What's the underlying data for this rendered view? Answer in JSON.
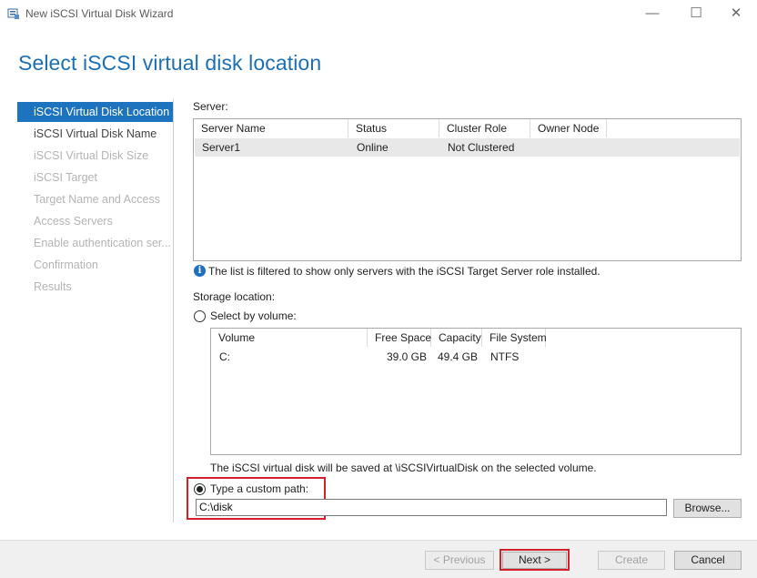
{
  "window": {
    "title": "New iSCSI Virtual Disk Wizard",
    "minimize_glyph": "—",
    "maximize_glyph": "☐",
    "close_glyph": "✕"
  },
  "page_heading": "Select iSCSI virtual disk location",
  "nav": {
    "items": [
      {
        "label": "iSCSI Virtual Disk Location",
        "state": "active"
      },
      {
        "label": "iSCSI Virtual Disk Name",
        "state": "enabled"
      },
      {
        "label": "iSCSI Virtual Disk Size",
        "state": "disabled"
      },
      {
        "label": "iSCSI Target",
        "state": "disabled"
      },
      {
        "label": "Target Name and Access",
        "state": "disabled"
      },
      {
        "label": "Access Servers",
        "state": "disabled"
      },
      {
        "label": "Enable authentication ser...",
        "state": "disabled"
      },
      {
        "label": "Confirmation",
        "state": "disabled"
      },
      {
        "label": "Results",
        "state": "disabled"
      }
    ]
  },
  "server_section": {
    "label": "Server:",
    "columns": [
      "Server Name",
      "Status",
      "Cluster Role",
      "Owner Node"
    ],
    "rows": [
      {
        "server_name": "Server1",
        "status": "Online",
        "cluster_role": "Not Clustered",
        "owner_node": ""
      }
    ],
    "info_text": "The list is filtered to show only servers with the iSCSI Target Server role installed."
  },
  "storage": {
    "label": "Storage location:",
    "by_volume_label": "Select by volume:",
    "by_volume_selected": false,
    "volume_columns": [
      "Volume",
      "Free Space",
      "Capacity",
      "File System"
    ],
    "volumes": [
      {
        "volume": "C:",
        "free_space": "39.0 GB",
        "capacity": "49.4 GB",
        "file_system": "NTFS"
      }
    ],
    "save_note": "The iSCSI virtual disk will be saved at \\iSCSIVirtualDisk on the selected volume.",
    "custom_path_label": "Type a custom path:",
    "custom_path_selected": true,
    "custom_path_value": "C:\\disk",
    "browse_label": "Browse..."
  },
  "footer": {
    "previous_label": "< Previous",
    "next_label": "Next >",
    "create_label": "Create",
    "cancel_label": "Cancel"
  },
  "colors": {
    "accent": "#1e73be",
    "heading": "#1c6fb3",
    "highlight_frame": "#d4202a"
  }
}
